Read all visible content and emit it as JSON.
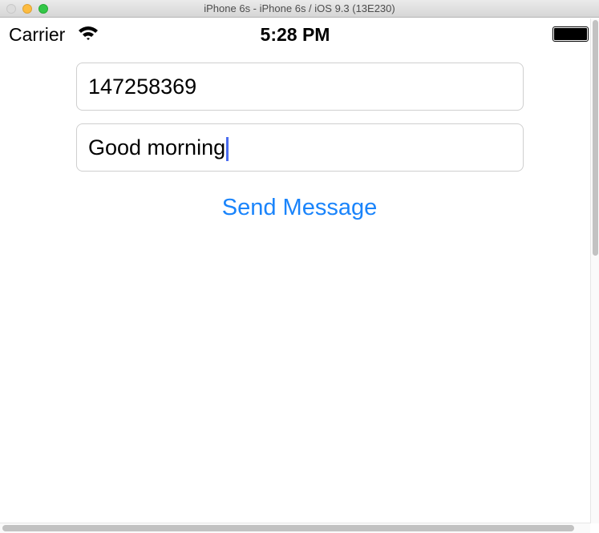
{
  "window": {
    "title": "iPhone 6s - iPhone 6s / iOS 9.3 (13E230)"
  },
  "status_bar": {
    "carrier": "Carrier",
    "time": "5:28 PM"
  },
  "form": {
    "phone_value": "147258369",
    "message_value": "Good morning",
    "send_label": "Send Message"
  },
  "colors": {
    "accent": "#1a84fb"
  }
}
